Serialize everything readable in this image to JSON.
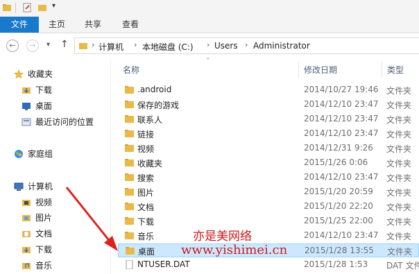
{
  "ribbon": {
    "tabs": [
      "文件",
      "主页",
      "共享",
      "查看"
    ]
  },
  "address": {
    "crumbs": [
      "计算机",
      "本地磁盘 (C:)",
      "Users",
      "Administrator"
    ],
    "back": "←",
    "forward": "→",
    "recent": "▾",
    "up": "↑"
  },
  "nav": {
    "favorites_header": "收藏夹",
    "favorites": [
      "下载",
      "桌面",
      "最近访问的位置"
    ],
    "homegroup": "家庭组",
    "computer_header": "计算机",
    "computer": [
      "视频",
      "图片",
      "文档",
      "下载",
      "音乐"
    ]
  },
  "columns": {
    "name": "名称",
    "date": "修改日期",
    "type": "类型"
  },
  "files": [
    {
      "name": ".android",
      "date": "2014/10/27 19:46",
      "type": "文件夹"
    },
    {
      "name": "保存的游戏",
      "date": "2014/12/10 23:47",
      "type": "文件夹"
    },
    {
      "name": "联系人",
      "date": "2014/12/10 23:47",
      "type": "文件夹"
    },
    {
      "name": "链接",
      "date": "2014/12/10 23:47",
      "type": "文件夹"
    },
    {
      "name": "视频",
      "date": "2014/12/31 9:26",
      "type": "文件夹"
    },
    {
      "name": "收藏夹",
      "date": "2015/1/26 0:06",
      "type": "文件夹"
    },
    {
      "name": "搜索",
      "date": "2014/12/10 23:47",
      "type": "文件夹"
    },
    {
      "name": "图片",
      "date": "2015/1/20 20:59",
      "type": "文件夹"
    },
    {
      "name": "文档",
      "date": "2015/1/20 22:20",
      "type": "文件夹"
    },
    {
      "name": "下载",
      "date": "2015/1/25 22:00",
      "type": "文件夹"
    },
    {
      "name": "音乐",
      "date": "2014/12/10 23:47",
      "type": "文件夹"
    },
    {
      "name": "桌面",
      "date": "2015/1/28 13:55",
      "type": "文件夹"
    },
    {
      "name": "NTUSER.DAT",
      "date": "2015/1/28 1:53",
      "type": "DAT 文件"
    }
  ],
  "watermark": {
    "line1": "亦是美网络",
    "line2": "www.yishimei.cn"
  },
  "colors": {
    "accent": "#1979ca",
    "folder": "#e9b949",
    "selected": "#cce8ff",
    "annotation": "#cc1a1a"
  }
}
